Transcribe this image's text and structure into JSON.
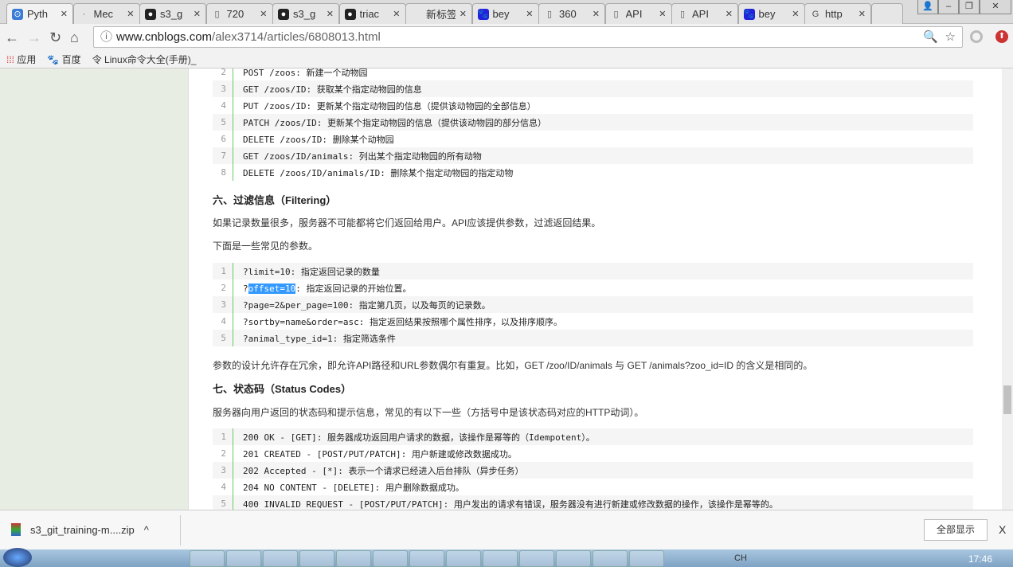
{
  "browser": {
    "tabs": [
      {
        "title": "Pyth",
        "icon": "python-icon",
        "active": true
      },
      {
        "title": "Mec",
        "icon": "dot-icon"
      },
      {
        "title": "s3_g",
        "icon": "github-icon"
      },
      {
        "title": "720",
        "icon": "page-icon"
      },
      {
        "title": "s3_g",
        "icon": "github-icon"
      },
      {
        "title": "triac",
        "icon": "github-icon"
      },
      {
        "title": "新标签页",
        "icon": ""
      },
      {
        "title": "bey",
        "icon": "baidu-icon"
      },
      {
        "title": "360",
        "icon": "page-icon"
      },
      {
        "title": "API",
        "icon": "page-icon"
      },
      {
        "title": "API",
        "icon": "page-icon"
      },
      {
        "title": "bey",
        "icon": "baidu-icon"
      },
      {
        "title": "http",
        "icon": "google-icon"
      }
    ],
    "url_host": "www.cnblogs.com",
    "url_path": "/alex3714/articles/6808013.html",
    "bookmarks": [
      {
        "label": "应用",
        "icon": "apps-icon"
      },
      {
        "label": "百度",
        "icon": "baidu-icon"
      },
      {
        "label": "Linux命令大全(手册)_",
        "icon": "linux-icon"
      }
    ]
  },
  "article": {
    "block1": [
      {
        "n": "2",
        "code": "POST /zoos",
        "text": ": 新建一个动物园"
      },
      {
        "n": "3",
        "code": "GET /zoos/ID",
        "text": ": 获取某个指定动物园的信息"
      },
      {
        "n": "4",
        "code": "PUT /zoos/ID",
        "text": ": 更新某个指定动物园的信息（提供该动物园的全部信息）"
      },
      {
        "n": "5",
        "code": "PATCH /zoos/ID",
        "text": ": 更新某个指定动物园的信息（提供该动物园的部分信息）"
      },
      {
        "n": "6",
        "code": "DELETE /zoos/ID",
        "text": ": 删除某个动物园"
      },
      {
        "n": "7",
        "code": "GET /zoos/ID/animals",
        "text": ": 列出某个指定动物园的所有动物"
      },
      {
        "n": "8",
        "code": "DELETE /zoos/ID/animals/ID",
        "text": ": 删除某个指定动物园的指定动物"
      }
    ],
    "heading6": "六、过滤信息（Filtering）",
    "para6a": "如果记录数量很多，服务器不可能都将它们返回给用户。API应该提供参数，过滤返回结果。",
    "para6b": "下面是一些常见的参数。",
    "block2": [
      {
        "n": "1",
        "code": "?limit=10",
        "text": ": 指定返回记录的数量"
      },
      {
        "n": "2",
        "pre": "?",
        "sel": "offset=10",
        "text": ": 指定返回记录的开始位置。"
      },
      {
        "n": "3",
        "code": "?page=2&per_page=100",
        "text": ": 指定第几页，以及每页的记录数。"
      },
      {
        "n": "4",
        "code": "?sortby=name&order=asc",
        "text": ": 指定返回结果按照哪个属性排序，以及排序顺序。"
      },
      {
        "n": "5",
        "code": "?animal_type_id=1",
        "text": ": 指定筛选条件"
      }
    ],
    "para6c": "参数的设计允许存在冗余，即允许API路径和URL参数偶尔有重复。比如，GET /zoo/ID/animals 与 GET /animals?zoo_id=ID 的含义是相同的。",
    "heading7": "七、状态码（Status Codes）",
    "para7": "服务器向用户返回的状态码和提示信息，常见的有以下一些（方括号中是该状态码对应的HTTP动词）。",
    "block3": [
      {
        "n": "1",
        "code": "200 OK - [GET]",
        "text": ": 服务器成功返回用户请求的数据，该操作是幂等的（Idempotent）。"
      },
      {
        "n": "2",
        "code": "201 CREATED - [POST/PUT/PATCH]",
        "text": ": 用户新建或修改数据成功。"
      },
      {
        "n": "3",
        "code": "202 Accepted - [*]",
        "text": ": 表示一个请求已经进入后台排队（异步任务）"
      },
      {
        "n": "4",
        "code": "204 NO CONTENT - [DELETE]",
        "text": ": 用户删除数据成功。"
      },
      {
        "n": "5",
        "code": "400 INVALID REQUEST - [POST/PUT/PATCH]",
        "text": ": 用户发出的请求有错误，服务器没有进行新建或修改数据的操作，该操作是幂等的。"
      }
    ]
  },
  "downloads": {
    "file": "s3_git_training-m....zip",
    "show_all": "全部显示",
    "close": "X"
  },
  "taskbar": {
    "lang": "CH",
    "time": "17:46"
  }
}
